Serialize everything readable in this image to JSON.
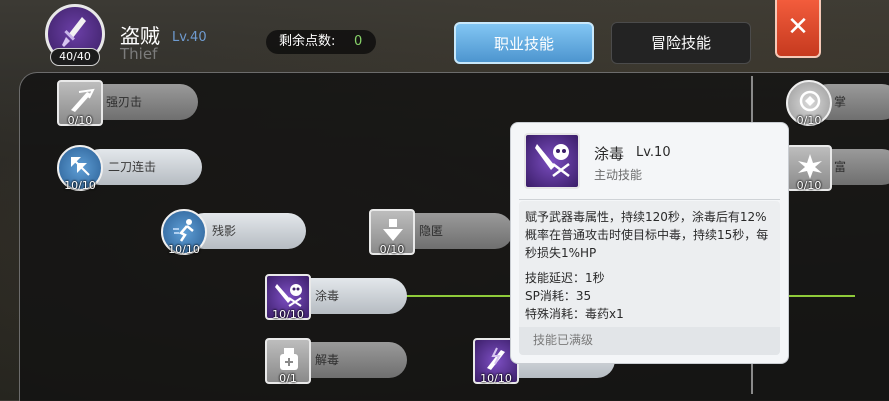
{
  "header": {
    "class_name": "盗贼",
    "class_level": "Lv.40",
    "class_en": "Thief",
    "job_points": "40/40",
    "remaining_points_label": "剩余点数:",
    "remaining_points_value": "0",
    "tabs": [
      "职业技能",
      "冒险技能"
    ],
    "close_symbol": "✕"
  },
  "skills": [
    {
      "name": "强刃击",
      "count": "0/10"
    },
    {
      "name": "二刀连击",
      "count": "10/10"
    },
    {
      "name": "残影",
      "count": "10/10"
    },
    {
      "name": "隐匿",
      "count": "0/10"
    },
    {
      "name": "涂毒",
      "count": "10/10"
    },
    {
      "name": "解毒",
      "count": "0/1"
    },
    {
      "name": "",
      "count": "10/10"
    },
    {
      "name": "掌",
      "count": "0/10"
    },
    {
      "name": "富",
      "count": "0/10"
    }
  ],
  "tooltip": {
    "name": "涂毒",
    "level": "Lv.10",
    "type": "主动技能",
    "description": "赋予武器毒属性，持续120秒，涂毒后有12%概率在普通攻击时使目标中毒，持续15秒，每秒损失1%HP",
    "stats": [
      "技能延迟：1秒",
      "SP消耗：35",
      "特殊消耗：毒药x1"
    ],
    "max_text": "技能已满级"
  },
  "colors": {
    "accent_tab": "#5fa9e0",
    "close_red": "#e04a2c",
    "link_green": "#8fcb3a",
    "points_green": "#88d36a",
    "level_blue": "#6f9bd0",
    "skill_purple": "#5b3596"
  }
}
